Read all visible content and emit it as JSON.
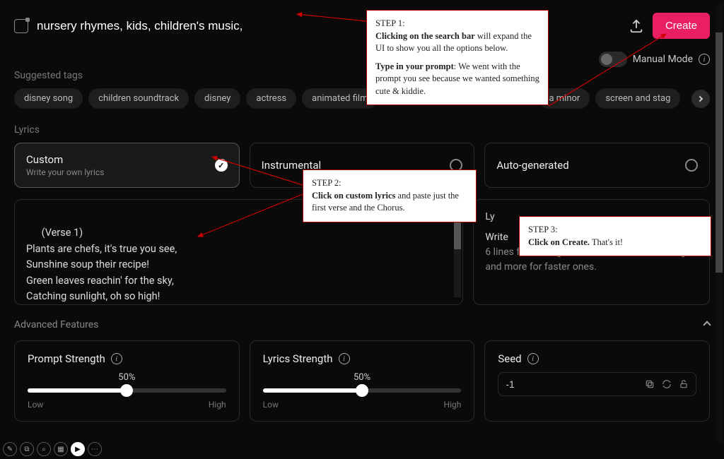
{
  "header": {
    "prompt_value": "nursery rhymes, kids, children's music,",
    "create_label": "Create"
  },
  "mode": {
    "label": "Manual Mode"
  },
  "tags": {
    "section_label": "Suggested tags",
    "items": [
      "disney song",
      "children soundtrack",
      "disney",
      "actress",
      "animated film",
      "a minor",
      "screen and stag"
    ]
  },
  "lyrics": {
    "section_label": "Lyrics",
    "options": [
      {
        "title": "Custom",
        "sub": "Write your own lyrics",
        "selected": true
      },
      {
        "title": "Instrumental",
        "sub": "",
        "selected": false
      },
      {
        "title": "Auto-generated",
        "sub": "",
        "selected": false
      }
    ],
    "editor_text": "(Verse 1)\nPlants are chefs, it's true you see,\nSunshine soup their recipe!\nGreen leaves reachin' for the sky,\nCatching sunlight, oh so high!\n\n(Chorus)",
    "tips_title": "Ly",
    "tips_write": "Write",
    "tips_body": "6 lines for most genres, fewer for slower songs, and more for faster ones."
  },
  "advanced": {
    "label": "Advanced Features",
    "prompt_strength": {
      "title": "Prompt Strength",
      "value": "50%",
      "low": "Low",
      "high": "High"
    },
    "lyrics_strength": {
      "title": "Lyrics Strength",
      "value": "50%",
      "low": "Low",
      "high": "High"
    },
    "seed": {
      "title": "Seed",
      "value": "-1"
    }
  },
  "callouts": {
    "step1": {
      "title": "STEP 1:",
      "line1a": "Clicking on the search bar",
      "line1b": " will expand the UI to show you all the options below.",
      "line2a": "Type in your prompt",
      "line2b": ": We went with the prompt you see because we wanted something cute & kiddie."
    },
    "step2": {
      "title": "STEP 2:",
      "line1a": "Click on custom lyrics",
      "line1b": " and paste just the first verse and the Chorus."
    },
    "step3": {
      "title": "STEP 3:",
      "line1a": "Click on Create.",
      "line1b": " That's it!"
    }
  }
}
